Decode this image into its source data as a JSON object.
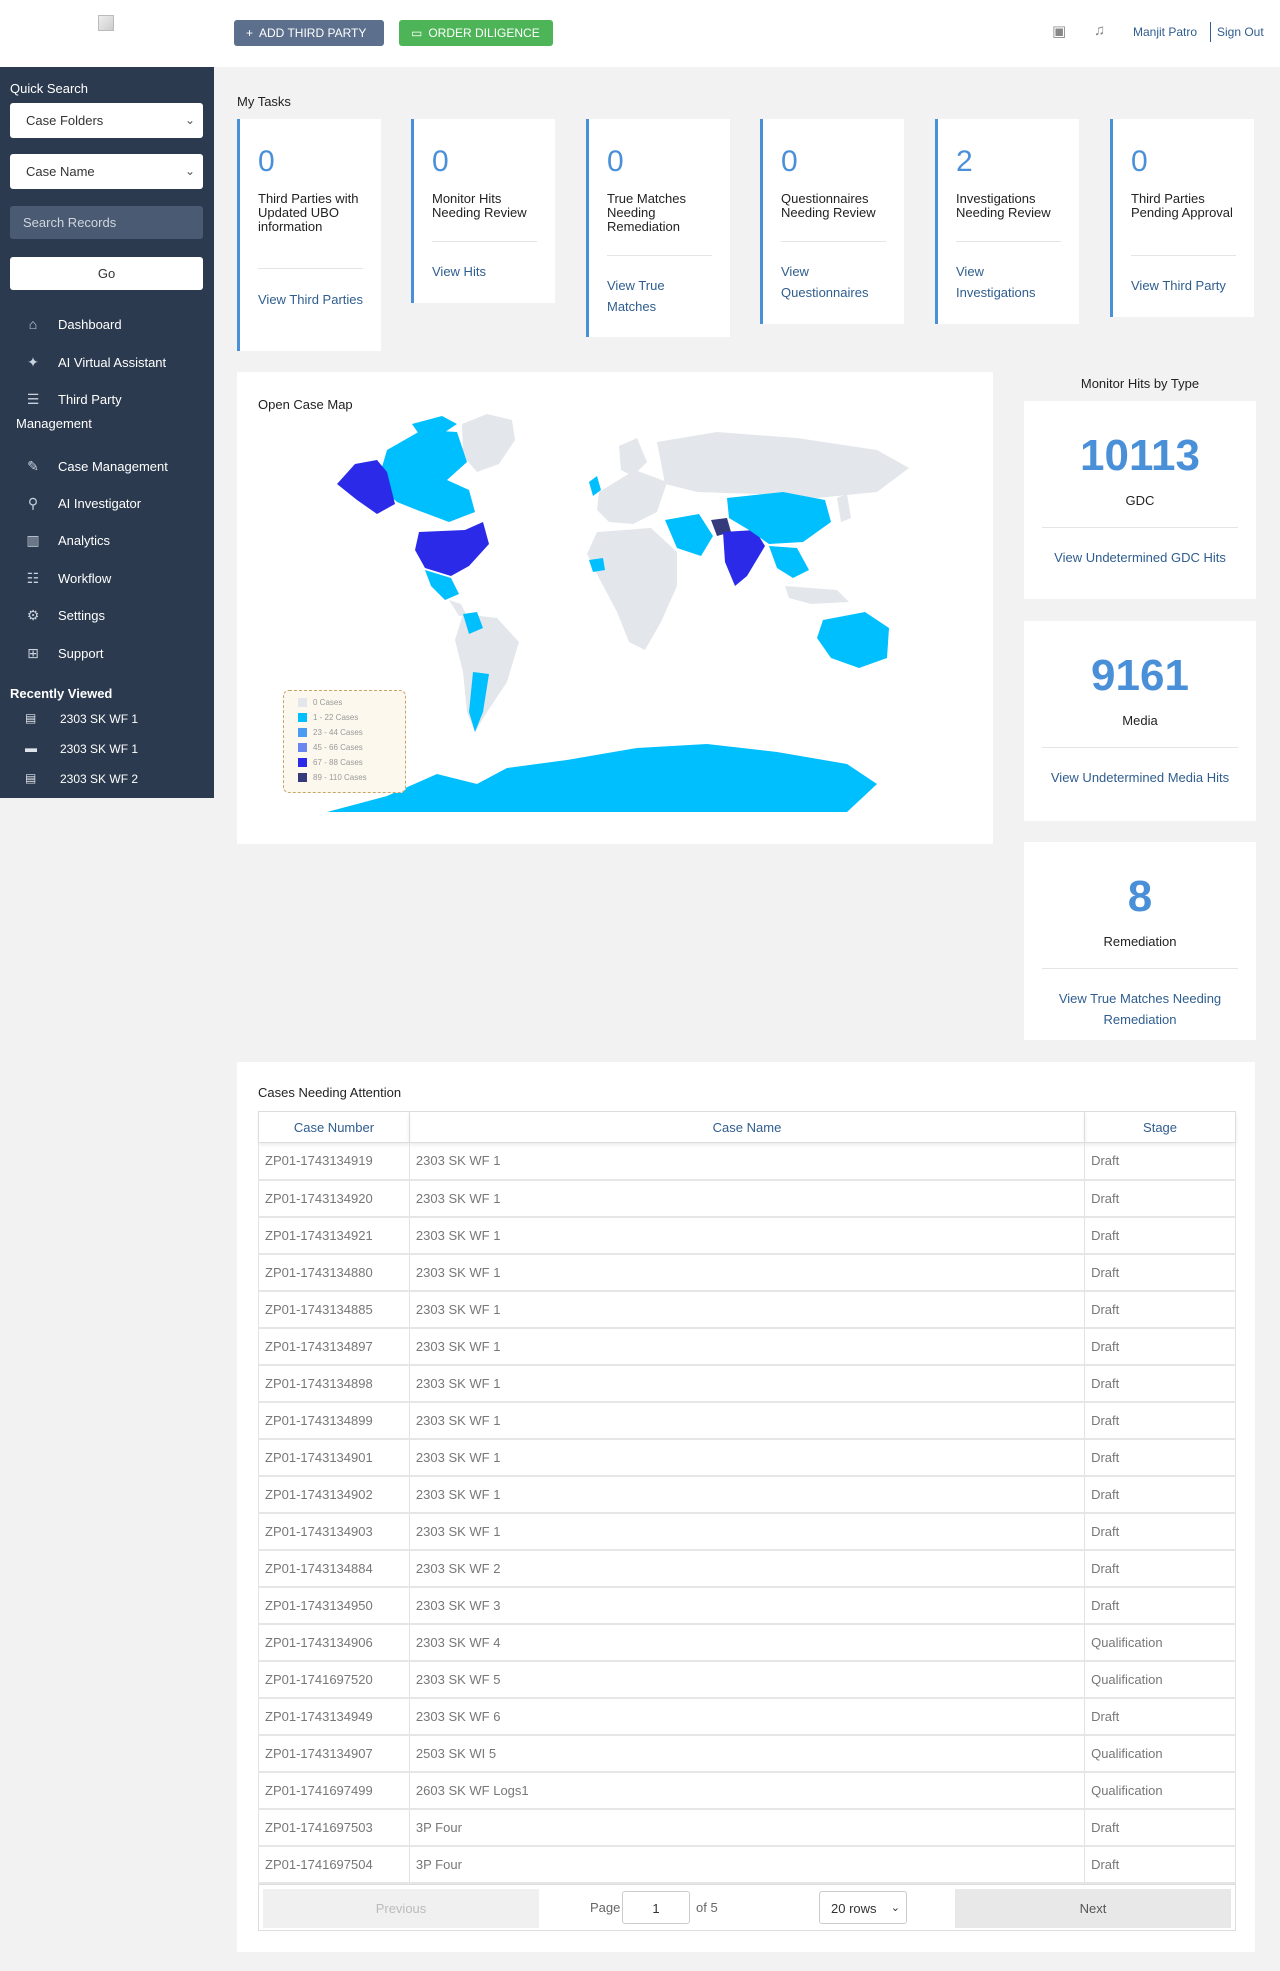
{
  "header": {
    "add_third_party": "ADD THIRD PARTY",
    "order_diligence": "ORDER DILIGENCE",
    "user_name": "Manjit Patro",
    "sign_out": "Sign Out"
  },
  "sidebar": {
    "quick_search_label": "Quick Search",
    "case_folders": "Case Folders",
    "case_name": "Case Name",
    "search_placeholder": "Search Records",
    "go": "Go",
    "nav": [
      {
        "label": "Dashboard",
        "icon": "home-icon"
      },
      {
        "label": "AI Virtual Assistant",
        "icon": "sparkle-icon"
      },
      {
        "label": "Third Party",
        "icon": "list-icon"
      },
      {
        "label": "Management",
        "icon": ""
      },
      {
        "label": "Case Management",
        "icon": "pencil-icon"
      },
      {
        "label": "AI Investigator",
        "icon": "search-icon"
      },
      {
        "label": "Analytics",
        "icon": "bar-chart-icon"
      },
      {
        "label": "Workflow",
        "icon": "workflow-icon"
      },
      {
        "label": "Settings",
        "icon": "gear-icon"
      },
      {
        "label": "Support",
        "icon": "support-icon"
      }
    ],
    "recently_viewed_title": "Recently Viewed",
    "recently_viewed": [
      {
        "label": "2303 SK WF 1",
        "icon": "id-card-icon"
      },
      {
        "label": "2303 SK WF 1",
        "icon": "folder-icon"
      },
      {
        "label": "2303 SK WF 2",
        "icon": "id-card-icon"
      }
    ]
  },
  "my_tasks": {
    "title": "My Tasks",
    "cards": [
      {
        "count": "0",
        "label": "Third Parties with Updated UBO information",
        "link": "View Third Parties"
      },
      {
        "count": "0",
        "label": "Monitor Hits Needing Review",
        "link": "View Hits"
      },
      {
        "count": "0",
        "label": "True Matches Needing Remediation",
        "link": "View True Matches"
      },
      {
        "count": "0",
        "label": "Questionnaires Needing Review",
        "link": "View Questionnaires"
      },
      {
        "count": "2",
        "label": "Investigations Needing Review",
        "link": "View Investigations"
      },
      {
        "count": "0",
        "label": "Third Parties Pending Approval",
        "link": "View Third Party"
      }
    ]
  },
  "map": {
    "title": "Open Case Map",
    "legend": [
      {
        "label": "0 Cases",
        "color": "#e3e7eb"
      },
      {
        "label": "1 - 22 Cases",
        "color": "#00bfff"
      },
      {
        "label": "23 - 44 Cases",
        "color": "#4a9bf2"
      },
      {
        "label": "45 - 66 Cases",
        "color": "#6a85f0"
      },
      {
        "label": "67 - 88 Cases",
        "color": "#2a2ae8"
      },
      {
        "label": "89 - 110 Cases",
        "color": "#343a7c"
      }
    ]
  },
  "monitor_hits": {
    "title": "Monitor Hits by Type",
    "cards": [
      {
        "value": "10113",
        "type": "GDC",
        "link": "View Undetermined GDC Hits"
      },
      {
        "value": "9161",
        "type": "Media",
        "link": "View Undetermined Media Hits"
      },
      {
        "value": "8",
        "type": "Remediation",
        "link": "View True Matches Needing Remediation"
      }
    ]
  },
  "cases": {
    "title": "Cases Needing Attention",
    "columns": [
      "Case Number",
      "Case Name",
      "Stage"
    ],
    "rows": [
      [
        "ZP01-1743134919",
        "2303 SK WF 1",
        "Draft"
      ],
      [
        "ZP01-1743134920",
        "2303 SK WF 1",
        "Draft"
      ],
      [
        "ZP01-1743134921",
        "2303 SK WF 1",
        "Draft"
      ],
      [
        "ZP01-1743134880",
        "2303 SK WF 1",
        "Draft"
      ],
      [
        "ZP01-1743134885",
        "2303 SK WF 1",
        "Draft"
      ],
      [
        "ZP01-1743134897",
        "2303 SK WF 1",
        "Draft"
      ],
      [
        "ZP01-1743134898",
        "2303 SK WF 1",
        "Draft"
      ],
      [
        "ZP01-1743134899",
        "2303 SK WF 1",
        "Draft"
      ],
      [
        "ZP01-1743134901",
        "2303 SK WF 1",
        "Draft"
      ],
      [
        "ZP01-1743134902",
        "2303 SK WF 1",
        "Draft"
      ],
      [
        "ZP01-1743134903",
        "2303 SK WF 1",
        "Draft"
      ],
      [
        "ZP01-1743134884",
        "2303 SK WF 2",
        "Draft"
      ],
      [
        "ZP01-1743134950",
        "2303 SK WF 3",
        "Draft"
      ],
      [
        "ZP01-1743134906",
        "2303 SK WF 4",
        "Qualification"
      ],
      [
        "ZP01-1741697520",
        "2303 SK WF 5",
        "Qualification"
      ],
      [
        "ZP01-1743134949",
        "2303 SK WF 6",
        "Draft"
      ],
      [
        "ZP01-1743134907",
        "2503 SK WI 5",
        "Qualification"
      ],
      [
        "ZP01-1741697499",
        "2603 SK WF Logs1",
        "Qualification"
      ],
      [
        "ZP01-1741697503",
        "3P Four",
        "Draft"
      ],
      [
        "ZP01-1741697504",
        "3P Four",
        "Draft"
      ]
    ],
    "pager": {
      "previous": "Previous",
      "page_label": "Page",
      "page": "1",
      "of": "of 5",
      "rows": "20 rows",
      "next": "Next"
    }
  }
}
